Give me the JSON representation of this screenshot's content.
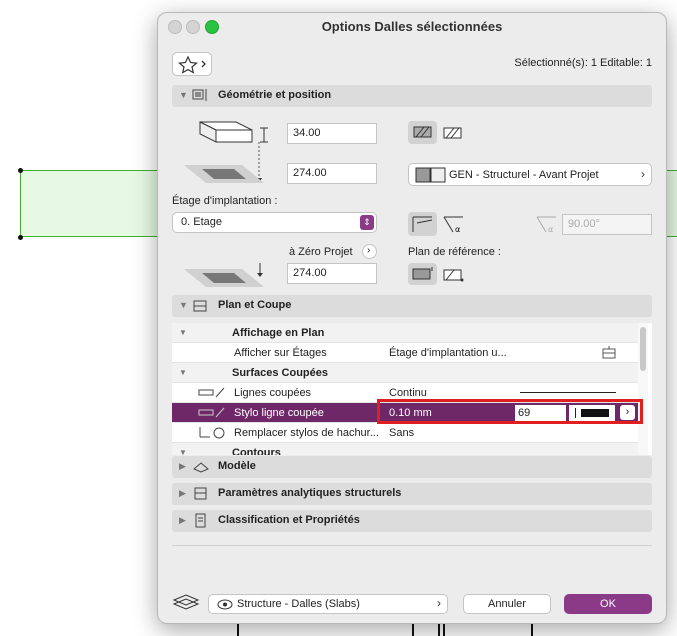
{
  "dialog": {
    "title": "Options Dalles sélectionnées",
    "selection_info": "Sélectionné(s): 1 Editable: 1"
  },
  "geometry": {
    "section_label": "Géométrie et position",
    "thickness": "34.00",
    "offset": "274.00",
    "home_story_label": "Étage d'implantation :",
    "home_story_value": "0. Etage",
    "zero_ref_label": "à Zéro Projet",
    "zero_ref_value": "274.00",
    "building_material": "GEN - Structurel - Avant Projet",
    "angle_value": "90.00°",
    "reference_plane_label": "Plan de référence :"
  },
  "plan_section": {
    "label": "Plan et Coupe",
    "rows": [
      {
        "type": "header",
        "label": "Affichage en Plan"
      },
      {
        "type": "item",
        "label": "Afficher sur Étages",
        "value": "Étage d'implantation u..."
      },
      {
        "type": "header",
        "label": "Surfaces Coupées"
      },
      {
        "type": "item",
        "label": "Lignes coupées",
        "value": "Continu"
      },
      {
        "type": "selected",
        "label": "Stylo ligne coupée",
        "value": "0.10 mm",
        "pen": "69"
      },
      {
        "type": "item",
        "label": "Remplacer stylos de hachur...",
        "value": "Sans"
      },
      {
        "type": "header",
        "label": "Contours"
      }
    ]
  },
  "sections": {
    "model": "Modèle",
    "structural": "Paramètres analytiques structurels",
    "classification": "Classification et Propriétés"
  },
  "footer": {
    "layer": "Structure - Dalles (Slabs)",
    "cancel": "Annuler",
    "ok": "OK"
  },
  "colors": {
    "accent": "#8a3a86",
    "selected_row": "#6e2868",
    "highlight_box": "#e02020",
    "slab_fill": "#e6f9e3",
    "slab_stroke": "#3fae33"
  }
}
